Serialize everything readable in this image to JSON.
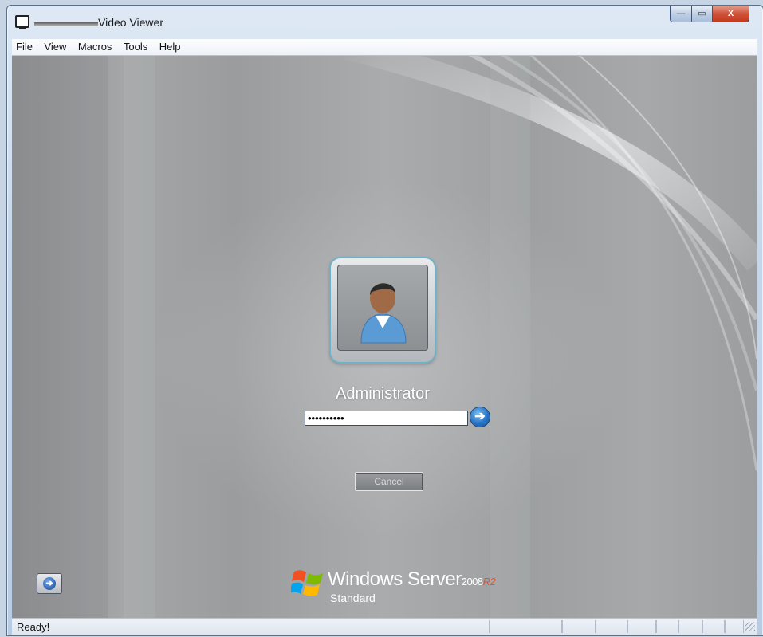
{
  "window": {
    "title": "Video Viewer",
    "controls": {
      "minimize": "—",
      "maximize": "▭",
      "close": "X"
    }
  },
  "menu": [
    "File",
    "View",
    "Macros",
    "Tools",
    "Help"
  ],
  "login": {
    "username": "Administrator",
    "password_masked": "••••••••••",
    "go_glyph": "➔",
    "cancel_label": "Cancel",
    "avatar_icon": "user-avatar-icon"
  },
  "branding": {
    "name": "Windows Server",
    "year": "2008",
    "r2": "R2",
    "edition": "Standard"
  },
  "ease_of_access": {
    "glyph": "➜"
  },
  "status": {
    "text": "Ready!"
  },
  "colors": {
    "accent_blue": "#2775c7",
    "r2_orange": "#e5542b",
    "close_red": "#c23a1f"
  }
}
